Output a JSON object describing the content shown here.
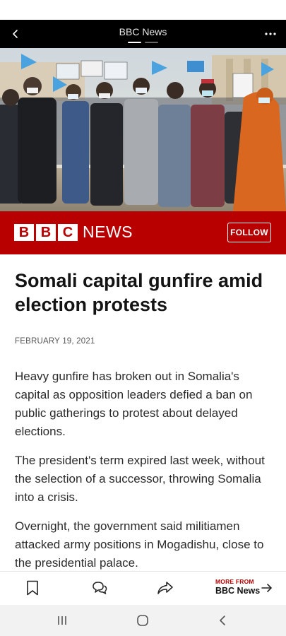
{
  "header": {
    "title": "BBC News",
    "back_icon": "chevron-left-icon",
    "menu_icon": "more-dots-icon",
    "pages": 2,
    "active_page": 1
  },
  "photo": {
    "description_icon": "protest-photo"
  },
  "brand": {
    "logo_letters": [
      "B",
      "B",
      "C"
    ],
    "news_word": "NEWS",
    "follow_label": "FOLLOW",
    "color": "#b80000"
  },
  "article": {
    "headline": "Somali capital gunfire amid election protests",
    "date": "FEBRUARY 19, 2021",
    "paragraphs": [
      "Heavy gunfire has broken out in Somalia's capital as opposition leaders defied a ban on public gatherings to protest about delayed elections.",
      "The president's term expired last week, without the selection of a successor, throwing Somalia into a crisis.",
      "Overnight, the government said militiamen attacked army positions in Mogadishu, close to the presidential palace."
    ]
  },
  "bottom_nav": {
    "bookmark_icon": "bookmark-icon",
    "comment_icon": "comment-icon",
    "share_icon": "share-icon",
    "more_from_label": "MORE FROM",
    "more_from_source": "BBC News",
    "arrow_icon": "arrow-right-icon"
  },
  "system_nav": {
    "recents_icon": "recents-icon",
    "home_icon": "home-icon",
    "back_icon": "back-icon"
  }
}
